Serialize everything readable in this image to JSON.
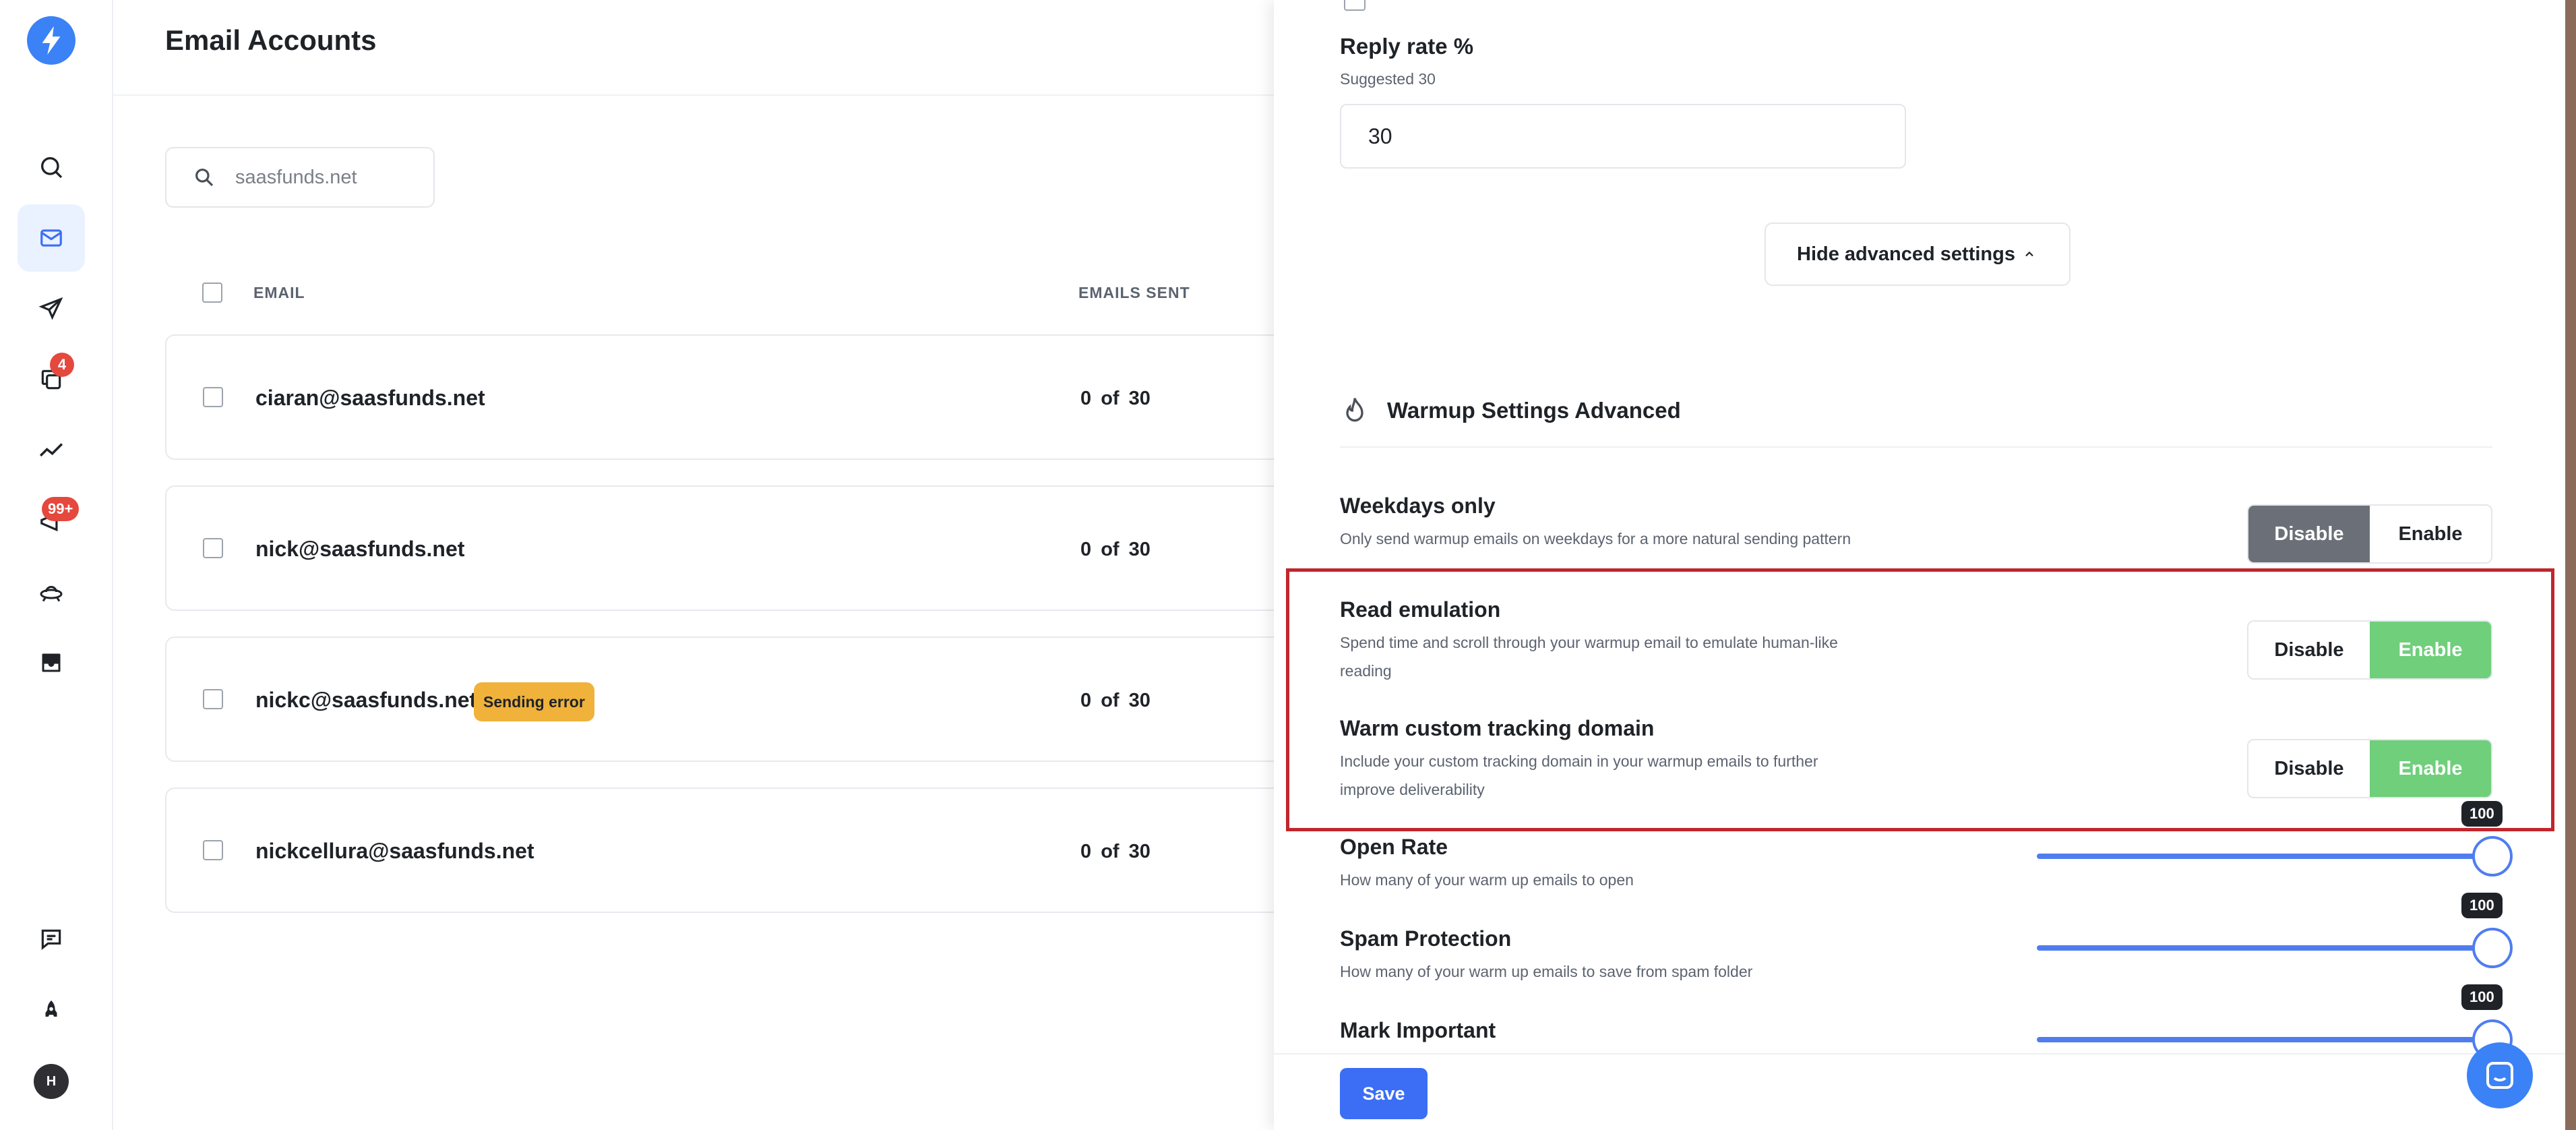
{
  "app": {
    "title": "Email Accounts"
  },
  "colors": {
    "brand": "#3b82f6",
    "error": "#f0b23a",
    "enable": "#6fcf7b",
    "highlight": "#c0262d"
  },
  "sidebar": {
    "items": [
      {
        "icon": "search-icon"
      },
      {
        "icon": "mail-icon",
        "active": true
      },
      {
        "icon": "send-icon"
      },
      {
        "icon": "copy-icon",
        "badge": "4"
      },
      {
        "icon": "analytics-icon"
      },
      {
        "icon": "megaphone-icon",
        "badge": "99+"
      },
      {
        "icon": "ufo-icon"
      },
      {
        "icon": "inbox-icon"
      }
    ],
    "bottom": [
      {
        "icon": "feedback-icon"
      },
      {
        "icon": "rocket-icon"
      }
    ],
    "avatar": "H"
  },
  "search": {
    "value": "saasfunds.net"
  },
  "table": {
    "headers": {
      "email": "EMAIL",
      "sent": "EMAILS SENT"
    },
    "rows": [
      {
        "email": "ciaran@saasfunds.net",
        "sent": "0",
        "of": "of",
        "limit": "30",
        "badge": ""
      },
      {
        "email": "nick@saasfunds.net",
        "sent": "0",
        "of": "of",
        "limit": "30",
        "badge": ""
      },
      {
        "email": "nickc@saasfunds.net",
        "sent": "0",
        "of": "of",
        "limit": "30",
        "badge": "Sending error"
      },
      {
        "email": "nickcellura@saasfunds.net",
        "sent": "0",
        "of": "of",
        "limit": "30",
        "badge": ""
      }
    ]
  },
  "panel": {
    "reply_rate": {
      "label": "Reply rate %",
      "hint": "Suggested 30",
      "value": "30"
    },
    "hide_advanced_label": "Hide advanced settings",
    "section_title": "Warmup Settings Advanced",
    "toggles": {
      "disable_label": "Disable",
      "enable_label": "Enable",
      "weekdays": {
        "title": "Weekdays only",
        "desc": "Only send warmup emails on weekdays for a more natural sending pattern",
        "selected": "Disable"
      },
      "read_emulation": {
        "title": "Read emulation",
        "desc1": "Spend time and scroll through your warmup email to emulate human-like",
        "desc2": "reading",
        "selected": "Enable"
      },
      "tracking": {
        "title": "Warm custom tracking domain",
        "desc1": "Include your custom tracking domain in your warmup emails to further",
        "desc2": "improve deliverability",
        "selected": "Enable"
      }
    },
    "sliders": {
      "open_rate": {
        "title": "Open Rate",
        "desc": "How many of your warm up emails to open",
        "value": "100"
      },
      "spam": {
        "title": "Spam Protection",
        "desc": "How many of your warm up emails to save from spam folder",
        "value": "100"
      },
      "important": {
        "title": "Mark Important",
        "desc": "",
        "value": "100"
      }
    },
    "save_label": "Save"
  }
}
